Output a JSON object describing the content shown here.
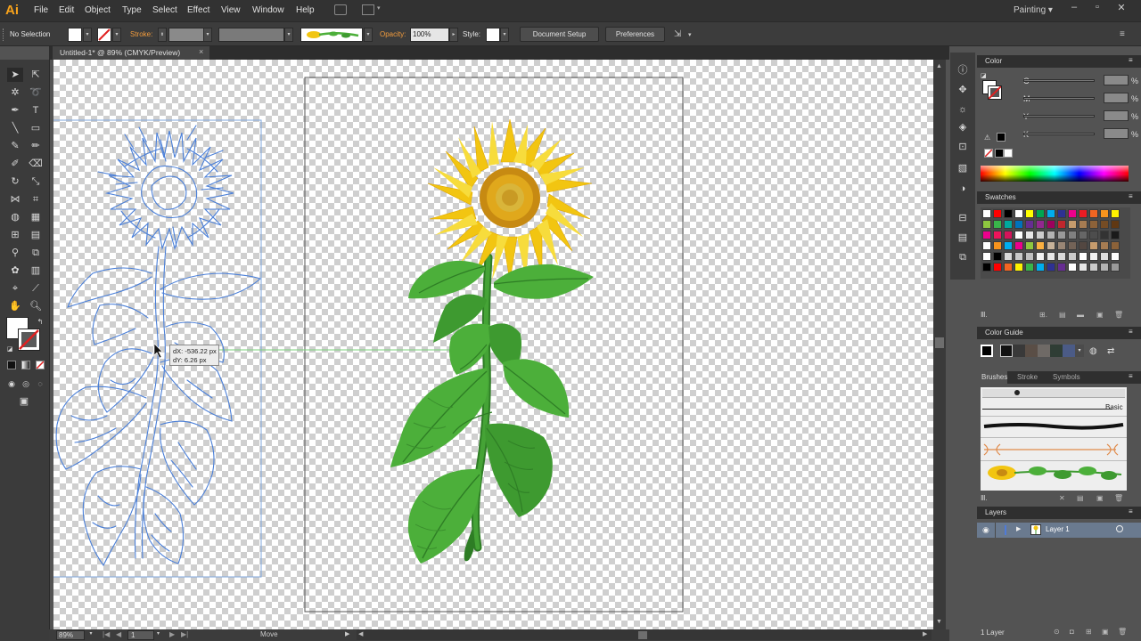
{
  "menubar": {
    "logo": "Ai",
    "items": [
      "File",
      "Edit",
      "Object",
      "Type",
      "Select",
      "Effect",
      "View",
      "Window",
      "Help"
    ],
    "workspace": "Painting",
    "workspace_arrow": "▾"
  },
  "controlbar": {
    "selection_label": "No Selection",
    "stroke_label": "Stroke:",
    "opacity_label": "Opacity:",
    "opacity_value": "100%",
    "style_label": "Style:",
    "document_setup": "Document Setup",
    "preferences": "Preferences"
  },
  "document": {
    "tab_title": "Untitled-1* @ 89% (CMYK/Preview)",
    "close": "×"
  },
  "tooltip": {
    "dx": "dX: -536.22 px",
    "dy": "dY: 6.26 px"
  },
  "status": {
    "zoom": "89%",
    "artboard": "1",
    "tool": "Move"
  },
  "panels": {
    "color": {
      "title": "Color",
      "channels": [
        {
          "label": "C",
          "unit": "%"
        },
        {
          "label": "M",
          "unit": "%"
        },
        {
          "label": "Y",
          "unit": "%"
        },
        {
          "label": "K",
          "unit": "%"
        }
      ]
    },
    "swatches": {
      "title": "Swatches"
    },
    "color_guide": {
      "title": "Color Guide"
    },
    "brushes": {
      "tabs": [
        "Brushes",
        "Stroke",
        "Symbols"
      ],
      "basic_label": "Basic"
    },
    "layers": {
      "title": "Layers",
      "layer_name": "Layer 1",
      "count": "1 Layer"
    }
  },
  "colors": {
    "accent": "#f7a21b",
    "selection": "#4a90e2",
    "sunflower": "#f2c511",
    "leaf": "#4caf3a",
    "leaf_dark": "#2e7d25"
  }
}
